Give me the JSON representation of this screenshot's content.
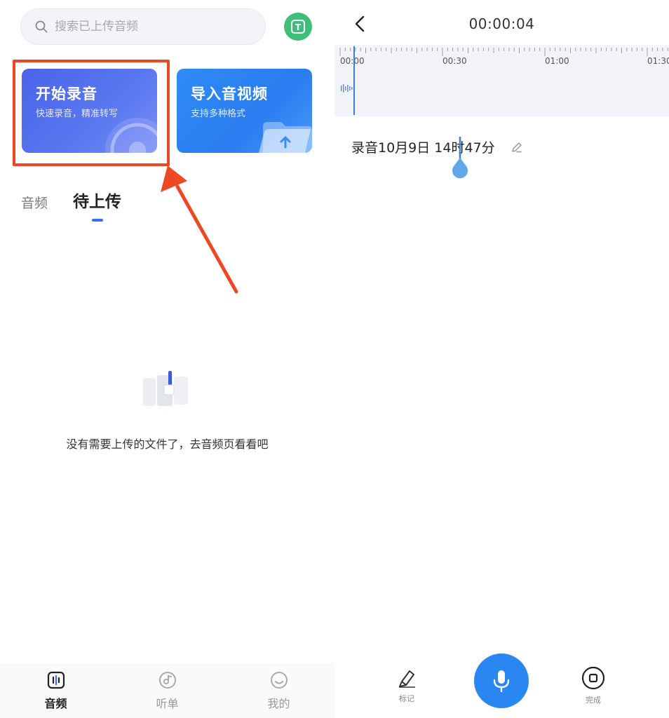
{
  "left": {
    "search": {
      "placeholder": "搜索已上传音频"
    },
    "avatar_label": "T",
    "cards": [
      {
        "title": "开始录音",
        "subtitle": "快速录音，精准转写"
      },
      {
        "title": "导入音视频",
        "subtitle": "支持多种格式"
      }
    ],
    "tabs": [
      {
        "label": "音频"
      },
      {
        "label": "待上传"
      }
    ],
    "empty_message": "没有需要上传的文件了，去音频页看看吧",
    "bottom_nav": [
      {
        "label": "音频"
      },
      {
        "label": "听单"
      },
      {
        "label": "我的"
      }
    ]
  },
  "right": {
    "timer": "00:00:04",
    "timeline_ticks": [
      "00:00",
      "00:30",
      "01:00",
      "01:30"
    ],
    "recording_title": "录音10月9日 14时47分",
    "controls": {
      "mark_label": "标记",
      "done_label": "完成"
    }
  },
  "colors": {
    "record_card": "#4a64e8",
    "import_card": "#2f8cf5",
    "highlight": "#ee4822",
    "accent": "#3b6ef5",
    "mic_button": "#2a86f0",
    "avatar": "#3fbd7a",
    "playhead": "#3a7fd9"
  },
  "icons": {
    "search": "search-icon",
    "back": "chevron-left-icon",
    "edit": "pencil-icon",
    "mark": "highlighter-icon",
    "mic": "microphone-icon",
    "done": "stop-icon"
  }
}
